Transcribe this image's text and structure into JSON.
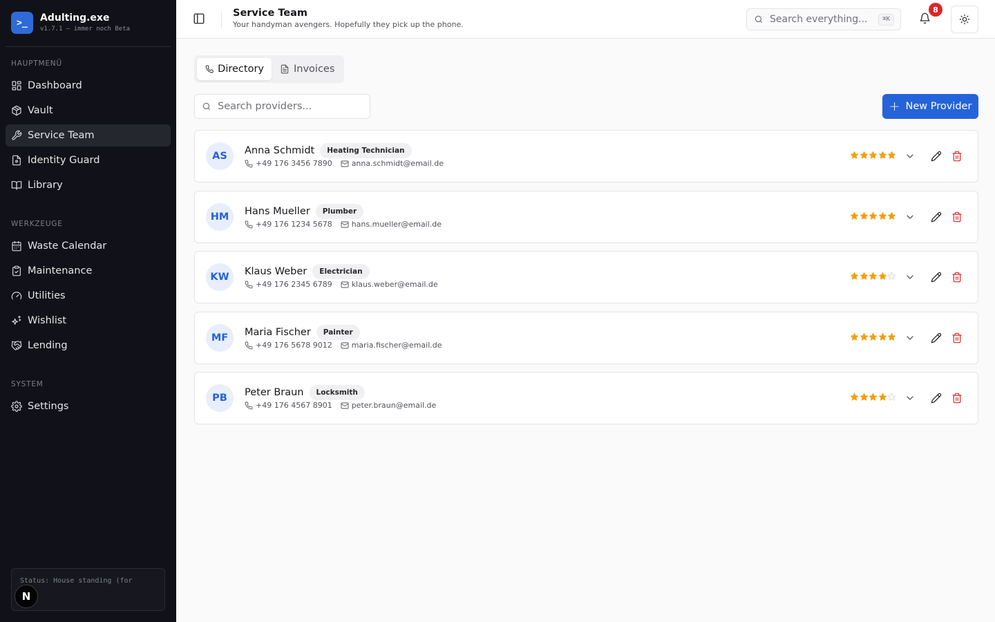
{
  "app": {
    "name": "Adulting.exe",
    "version": "v1.7.1 — immer noch Beta",
    "logo_glyph": ">_",
    "accent_color": "#2563d9"
  },
  "sidebar": {
    "sections": [
      {
        "heading": "HAUPTMENÜ",
        "items": [
          {
            "label": "Dashboard",
            "icon": "dashboard-icon",
            "active": false
          },
          {
            "label": "Vault",
            "icon": "vault-icon",
            "active": false
          },
          {
            "label": "Service Team",
            "icon": "wrench-icon",
            "active": true
          },
          {
            "label": "Identity Guard",
            "icon": "document-icon",
            "active": false
          },
          {
            "label": "Library",
            "icon": "book-icon",
            "active": false
          }
        ]
      },
      {
        "heading": "WERKZEUGE",
        "items": [
          {
            "label": "Waste Calendar",
            "icon": "calendar-icon",
            "active": false
          },
          {
            "label": "Maintenance",
            "icon": "clipboard-check-icon",
            "active": false
          },
          {
            "label": "Utilities",
            "icon": "gauge-icon",
            "active": false
          },
          {
            "label": "Wishlist",
            "icon": "sparkles-icon",
            "active": false
          },
          {
            "label": "Lending",
            "icon": "handshake-icon",
            "active": false
          }
        ]
      },
      {
        "heading": "SYSTEM",
        "items": [
          {
            "label": "Settings",
            "icon": "gear-icon",
            "active": false
          }
        ]
      }
    ],
    "status_text": "Status: House standing (for",
    "n_badge": "N"
  },
  "header": {
    "title": "Service Team",
    "subtitle": "Your handyman avengers. Hopefully they pick up the phone.",
    "search_placeholder": "Search everything...",
    "search_shortcut": "⌘K",
    "notification_count": "8"
  },
  "tabs": [
    {
      "label": "Directory",
      "icon": "phone-icon",
      "active": true
    },
    {
      "label": "Invoices",
      "icon": "invoice-icon",
      "active": false
    }
  ],
  "provider_search": {
    "placeholder": "Search providers..."
  },
  "new_provider_button": {
    "label": "New Provider"
  },
  "providers": [
    {
      "initials": "AS",
      "name": "Anna Schmidt",
      "trade": "Heating Technician",
      "phone": "+49 176 3456 7890",
      "email": "anna.schmidt@email.de",
      "rating": 5
    },
    {
      "initials": "HM",
      "name": "Hans Mueller",
      "trade": "Plumber",
      "phone": "+49 176 1234 5678",
      "email": "hans.mueller@email.de",
      "rating": 5
    },
    {
      "initials": "KW",
      "name": "Klaus Weber",
      "trade": "Electrician",
      "phone": "+49 176 2345 6789",
      "email": "klaus.weber@email.de",
      "rating": 4
    },
    {
      "initials": "MF",
      "name": "Maria Fischer",
      "trade": "Painter",
      "phone": "+49 176 5678 9012",
      "email": "maria.fischer@email.de",
      "rating": 5
    },
    {
      "initials": "PB",
      "name": "Peter Braun",
      "trade": "Locksmith",
      "phone": "+49 176 4567 8901",
      "email": "peter.braun@email.de",
      "rating": 4
    }
  ],
  "colors": {
    "star_filled": "#f59e0b",
    "star_empty": "#d4d4d8",
    "delete": "#dc2626",
    "sidebar_bg": "#111219"
  }
}
